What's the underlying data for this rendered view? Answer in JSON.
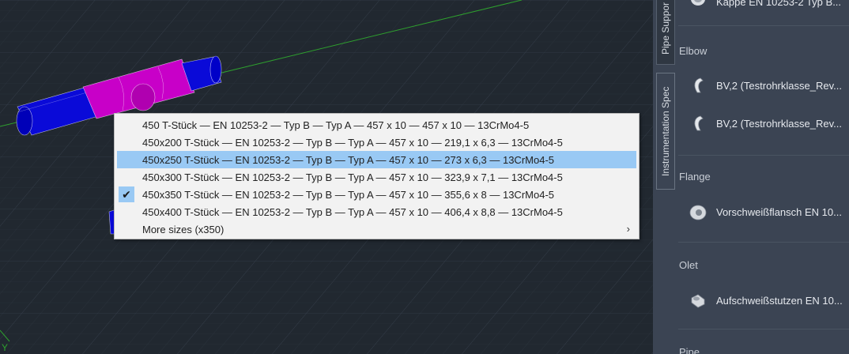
{
  "palette": {
    "tabs": [
      {
        "label": "Pipe Suppor",
        "active": false
      },
      {
        "label": "Instrumentation Spec",
        "active": true
      }
    ],
    "top_item": {
      "label": "Kappe EN 10253-2 Typ B...",
      "icon": "cap-icon"
    },
    "categories": [
      {
        "title": "Elbow",
        "items": [
          {
            "label": "BV,2 (Testrohrklasse_Rev...",
            "icon": "elbow-icon"
          },
          {
            "label": "BV,2 (Testrohrklasse_Rev...",
            "icon": "elbow-icon"
          }
        ]
      },
      {
        "title": "Flange",
        "items": [
          {
            "label": "Vorschweißflansch EN 10...",
            "icon": "flange-icon"
          }
        ]
      },
      {
        "title": "Olet",
        "items": [
          {
            "label": "Aufschweißstutzen EN 10...",
            "icon": "olet-icon"
          }
        ]
      },
      {
        "title": "Pipe",
        "items": []
      }
    ]
  },
  "context_menu": {
    "items": [
      {
        "label": "450 T-Stück — EN 10253-2 — Typ B — Typ A — 457 x 10 — 457 x 10 — 13CrMo4-5",
        "highlighted": false,
        "checked": false
      },
      {
        "label": "450x200 T-Stück — EN 10253-2 — Typ B — Typ A — 457 x 10 — 219,1 x 6,3 — 13CrMo4-5",
        "highlighted": false,
        "checked": false
      },
      {
        "label": "450x250 T-Stück — EN 10253-2 — Typ B — Typ A — 457 x 10 — 273 x 6,3 — 13CrMo4-5",
        "highlighted": true,
        "checked": false
      },
      {
        "label": "450x300 T-Stück — EN 10253-2 — Typ B — Typ A — 457 x 10 — 323,9 x 7,1 — 13CrMo4-5",
        "highlighted": false,
        "checked": false
      },
      {
        "label": "450x350 T-Stück — EN 10253-2 — Typ B — Typ A — 457 x 10 — 355,6 x 8 — 13CrMo4-5",
        "highlighted": false,
        "checked": true
      },
      {
        "label": "450x400 T-Stück — EN 10253-2 — Typ B — Typ A — 457 x 10 — 406,4 x 8,8 — 13CrMo4-5",
        "highlighted": false,
        "checked": false
      }
    ],
    "more": {
      "label": "More sizes (x350)",
      "arrow": "›"
    },
    "check_glyph": "✔"
  },
  "viewport": {
    "background": "#212830",
    "pipe_color": "#0a0ad8",
    "tee_color": "#c800c8",
    "axis_color": "#2ea02e",
    "axis_label": "Y"
  }
}
